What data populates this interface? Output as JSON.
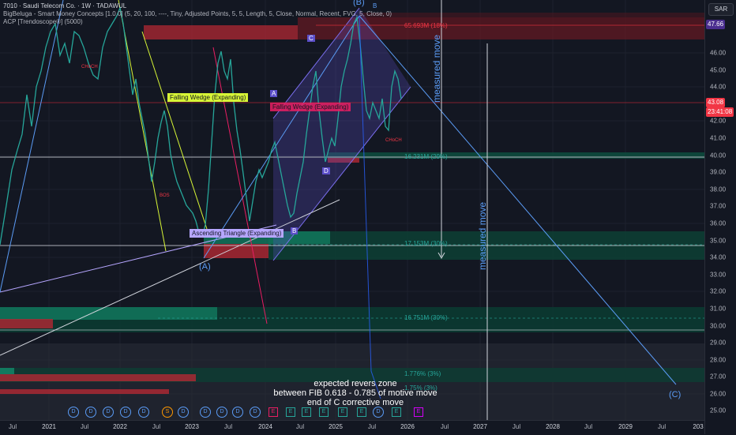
{
  "legend": {
    "symbol_line": "7010 · Saudi Telecom Co. · 1W · TADAWUL",
    "indicator1": "BigBeluga - Smart Money Concepts [1.0.0] (5, 20, 100, ----, Tiny, Adjusted Points, 5, 5, Length, 5, Close, Normal, Recent, FVG, 5, Close, 0)",
    "indicator2": "ACP [Trendoscope®] (5000)"
  },
  "currency": "SAR",
  "price_axis": {
    "ticks": [
      "46.00",
      "45.00",
      "44.00",
      "42.00",
      "41.00",
      "40.00",
      "39.00",
      "38.00",
      "37.00",
      "36.00",
      "35.00",
      "34.00",
      "33.00",
      "32.00",
      "31.00",
      "30.00",
      "29.00",
      "28.00",
      "27.00",
      "26.00",
      "25.00"
    ],
    "last_price": "43.08",
    "countdown": "23:41:08",
    "level_badge": "47.66",
    "colors": {
      "last_price_bg": "#f23645",
      "level_badge_bg": "#4a2e8f"
    }
  },
  "time_axis": {
    "ticks": [
      "Jul",
      "2021",
      "Jul",
      "2022",
      "Jul",
      "2023",
      "Jul",
      "2024",
      "Jul",
      "2025",
      "Jul",
      "2026",
      "Jul",
      "2027",
      "Jul",
      "2028",
      "Jul",
      "2029",
      "Jul",
      "203"
    ]
  },
  "annotations": {
    "fib_levels": [
      "65.693M (18%)",
      "16.231M (29%)",
      "17.153M (30%)",
      "16.751M (30%)",
      "1.776% (3%)",
      "1.75% (3%)"
    ],
    "wedge1": "Falling Wedge (Expanding)",
    "wedge2": "Falling Wedge (Expanding)",
    "triangle": "Ascending Triangle (Expanding)",
    "measured_move": "measured move",
    "wave_a": "(A)",
    "wave_b": "(B)",
    "wave_c": "(C)",
    "pivots": [
      "A",
      "B",
      "C",
      "D",
      "B"
    ],
    "choch": "CHoCH",
    "bos": "BOS",
    "note_lines": [
      "expected revers zone",
      "between FIB 0.618 - 0.785 of motive move",
      "end of C corrective move"
    ]
  },
  "event_markers": {
    "dividend": [
      "D",
      "D",
      "D",
      "D",
      "D",
      "S",
      "D",
      "D",
      "D",
      "D",
      "D",
      "D",
      "D",
      "D",
      "D"
    ],
    "earnings": [
      "E",
      "E",
      "E",
      "E",
      "E",
      "E",
      "E",
      "E"
    ]
  }
}
